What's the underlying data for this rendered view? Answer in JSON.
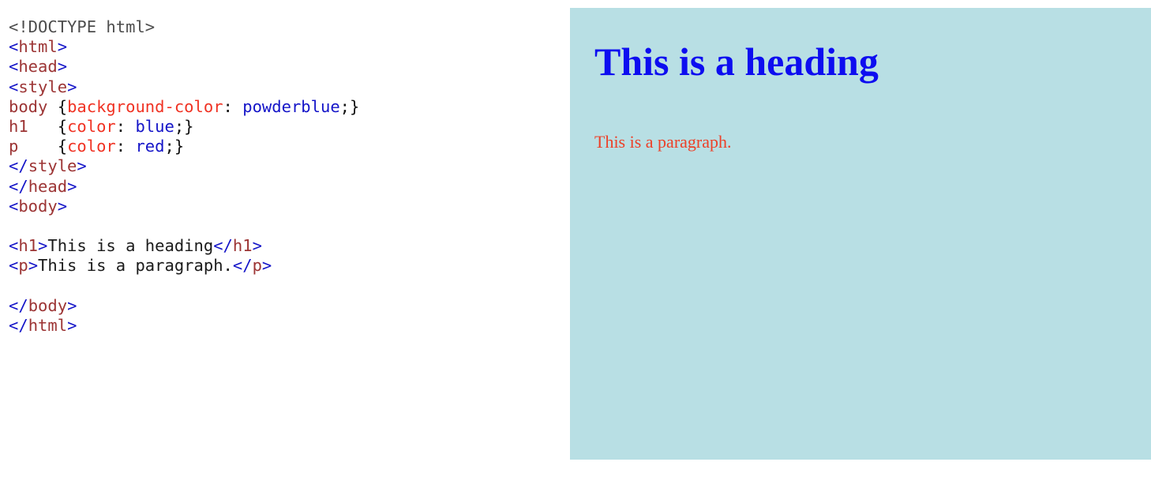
{
  "code_pane": {
    "language": "html",
    "lines": [
      {
        "id": "line-doctype",
        "tokens": [
          {
            "type": "doctype",
            "text": "<!DOCTYPE html>"
          }
        ]
      },
      {
        "id": "line-html-open",
        "tokens": [
          {
            "type": "bracket",
            "text": "<"
          },
          {
            "type": "tagname",
            "text": "html"
          },
          {
            "type": "bracket",
            "text": ">"
          }
        ]
      },
      {
        "id": "line-head-open",
        "tokens": [
          {
            "type": "bracket",
            "text": "<"
          },
          {
            "type": "tagname",
            "text": "head"
          },
          {
            "type": "bracket",
            "text": ">"
          }
        ]
      },
      {
        "id": "line-style-open",
        "tokens": [
          {
            "type": "bracket",
            "text": "<"
          },
          {
            "type": "tagname",
            "text": "style"
          },
          {
            "type": "bracket",
            "text": ">"
          }
        ]
      },
      {
        "id": "line-css-body",
        "tokens": [
          {
            "type": "selector",
            "text": "body"
          },
          {
            "type": "punct",
            "text": " {"
          },
          {
            "type": "property",
            "text": "background-color"
          },
          {
            "type": "punct",
            "text": ": "
          },
          {
            "type": "value",
            "text": "powderblue"
          },
          {
            "type": "punct",
            "text": ";}"
          }
        ]
      },
      {
        "id": "line-css-h1",
        "tokens": [
          {
            "type": "selector",
            "text": "h1"
          },
          {
            "type": "punct",
            "text": "   {"
          },
          {
            "type": "property",
            "text": "color"
          },
          {
            "type": "punct",
            "text": ": "
          },
          {
            "type": "value",
            "text": "blue"
          },
          {
            "type": "punct",
            "text": ";}"
          }
        ]
      },
      {
        "id": "line-css-p",
        "tokens": [
          {
            "type": "selector",
            "text": "p"
          },
          {
            "type": "punct",
            "text": "    {"
          },
          {
            "type": "property",
            "text": "color"
          },
          {
            "type": "punct",
            "text": ": "
          },
          {
            "type": "value",
            "text": "red"
          },
          {
            "type": "punct",
            "text": ";}"
          }
        ]
      },
      {
        "id": "line-style-close",
        "tokens": [
          {
            "type": "bracket",
            "text": "</"
          },
          {
            "type": "tagname",
            "text": "style"
          },
          {
            "type": "bracket",
            "text": ">"
          }
        ]
      },
      {
        "id": "line-head-close",
        "tokens": [
          {
            "type": "bracket",
            "text": "</"
          },
          {
            "type": "tagname",
            "text": "head"
          },
          {
            "type": "bracket",
            "text": ">"
          }
        ]
      },
      {
        "id": "line-body-open",
        "tokens": [
          {
            "type": "bracket",
            "text": "<"
          },
          {
            "type": "tagname",
            "text": "body"
          },
          {
            "type": "bracket",
            "text": ">"
          }
        ]
      },
      {
        "id": "line-blank-1",
        "tokens": []
      },
      {
        "id": "line-h1",
        "tokens": [
          {
            "type": "bracket",
            "text": "<"
          },
          {
            "type": "tagname",
            "text": "h1"
          },
          {
            "type": "bracket",
            "text": ">"
          },
          {
            "type": "text",
            "text": "This is a heading"
          },
          {
            "type": "bracket",
            "text": "</"
          },
          {
            "type": "tagname",
            "text": "h1"
          },
          {
            "type": "bracket",
            "text": ">"
          }
        ]
      },
      {
        "id": "line-p",
        "tokens": [
          {
            "type": "bracket",
            "text": "<"
          },
          {
            "type": "tagname",
            "text": "p"
          },
          {
            "type": "bracket",
            "text": ">"
          },
          {
            "type": "text",
            "text": "This is a paragraph."
          },
          {
            "type": "bracket",
            "text": "</"
          },
          {
            "type": "tagname",
            "text": "p"
          },
          {
            "type": "bracket",
            "text": ">"
          }
        ]
      },
      {
        "id": "line-blank-2",
        "tokens": []
      },
      {
        "id": "line-body-close",
        "tokens": [
          {
            "type": "bracket",
            "text": "</"
          },
          {
            "type": "tagname",
            "text": "body"
          },
          {
            "type": "bracket",
            "text": ">"
          }
        ]
      },
      {
        "id": "line-html-close",
        "tokens": [
          {
            "type": "bracket",
            "text": "</"
          },
          {
            "type": "tagname",
            "text": "html"
          },
          {
            "type": "bracket",
            "text": ">"
          }
        ]
      }
    ]
  },
  "preview_pane": {
    "background_color": "#b8dfe4",
    "heading": {
      "text": "This is a heading",
      "color": "#0d0df0"
    },
    "paragraph": {
      "text": "This is a paragraph.",
      "color": "#ed4028"
    }
  },
  "syntax_colors": {
    "doctype": "#4d4d4d",
    "bracket": "#1414c8",
    "tagname": "#9c3434",
    "text": "#1a1a1a",
    "selector": "#9c3434",
    "property": "#f03223",
    "value": "#1414c8",
    "punct": "#121212"
  }
}
